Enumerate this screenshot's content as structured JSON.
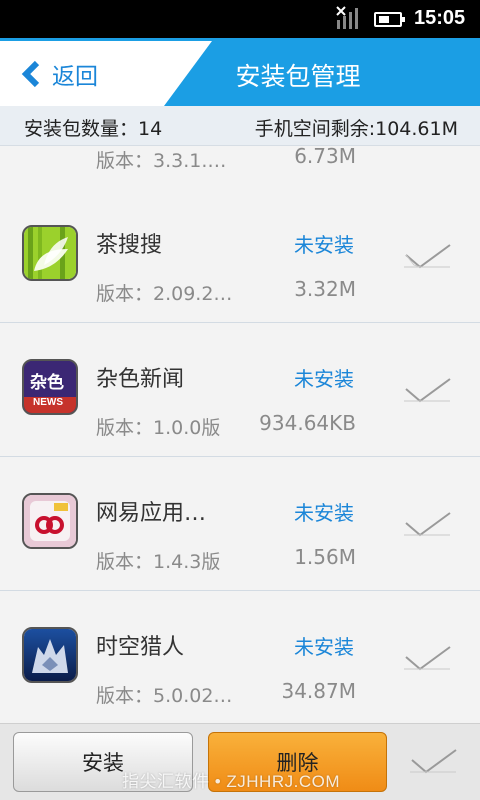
{
  "status_bar": {
    "time": "15:05"
  },
  "header": {
    "back_label": "返回",
    "title": "安装包管理"
  },
  "summary": {
    "count_text": "安装包数量：14",
    "space_text": "手机空间剩余:104.61M"
  },
  "list": {
    "items": [
      {
        "name": "",
        "status": "",
        "version": "版本：3.3.1.…",
        "size": "6.73M",
        "icon": "unknown-app-icon"
      },
      {
        "name": "茶搜搜",
        "status": "未安装",
        "version": "版本：2.09.2…",
        "size": "3.32M",
        "icon": "bamboo-leaf-icon"
      },
      {
        "name": "杂色新闻",
        "status": "未安装",
        "version": "版本：1.0.0版",
        "size": "934.64KB",
        "icon": "news-icon"
      },
      {
        "name": "网易应用…",
        "status": "未安装",
        "version": "版本：1.4.3版",
        "size": "1.56M",
        "icon": "netease-app-icon"
      },
      {
        "name": "时空猎人",
        "status": "未安装",
        "version": "版本：5.0.02…",
        "size": "34.87M",
        "icon": "wolf-game-icon"
      }
    ]
  },
  "icon_texts": {
    "news_top": "杂色",
    "news_bottom": "NEWS"
  },
  "footer": {
    "install_label": "安装",
    "delete_label": "删除",
    "watermark": "指尖汇软件 • ZJHHRJ.COM"
  },
  "colors": {
    "accent": "#1b9ee4",
    "status_text": "#1b86d8",
    "delete_button": "#f08c16"
  }
}
